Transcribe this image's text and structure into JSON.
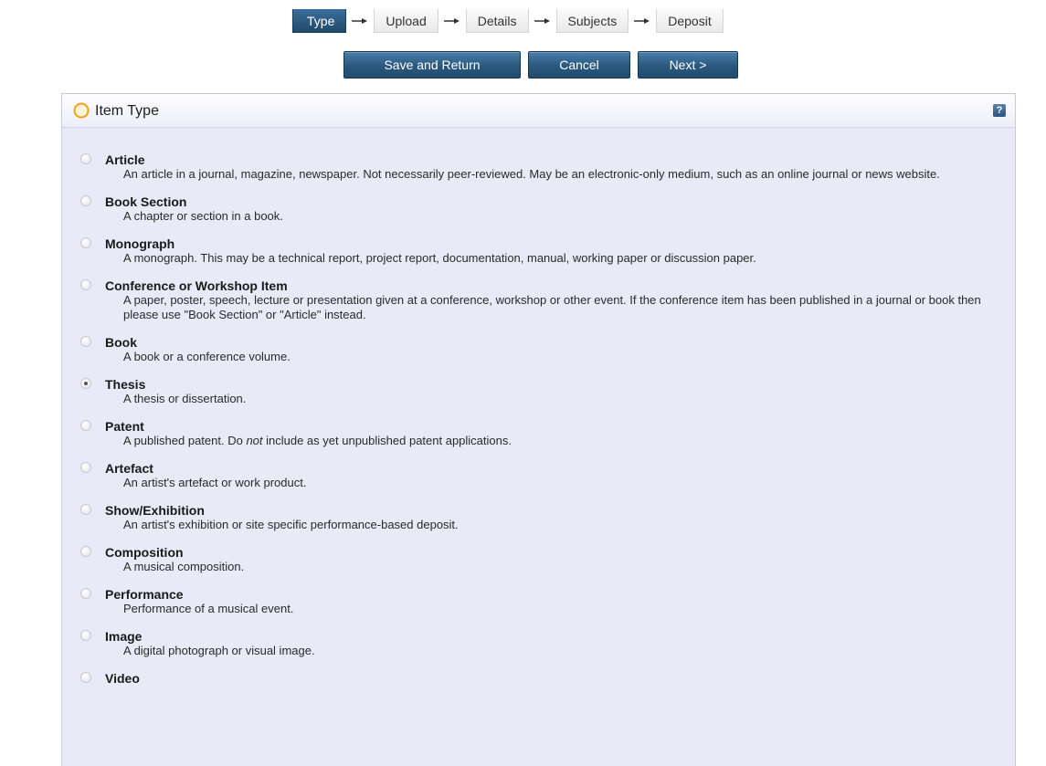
{
  "workflow": {
    "steps": [
      {
        "label": "Type",
        "active": true
      },
      {
        "label": "Upload",
        "active": false
      },
      {
        "label": "Details",
        "active": false
      },
      {
        "label": "Subjects",
        "active": false
      },
      {
        "label": "Deposit",
        "active": false
      }
    ],
    "arrow_icon": "arrow-right-icon"
  },
  "actions": {
    "save_label": "Save and Return",
    "cancel_label": "Cancel",
    "next_label": "Next >"
  },
  "panel": {
    "title": "Item Type",
    "required_icon": "required-circle-icon",
    "help_icon": "help-icon",
    "help_glyph": "?"
  },
  "item_types": [
    {
      "name": "Article",
      "description": "An article in a journal, magazine, newspaper. Not necessarily peer-reviewed. May be an electronic-only medium, such as an online journal or news website.",
      "selected": false
    },
    {
      "name": "Book Section",
      "description": "A chapter or section in a book.",
      "selected": false
    },
    {
      "name": "Monograph",
      "description": "A monograph. This may be a technical report, project report, documentation, manual, working paper or discussion paper.",
      "selected": false
    },
    {
      "name": "Conference or Workshop Item",
      "description": "A paper, poster, speech, lecture or presentation given at a conference, workshop or other event. If the conference item has been published in a journal or book then please use \"Book Section\" or \"Article\" instead.",
      "selected": false
    },
    {
      "name": "Book",
      "description": "A book or a conference volume.",
      "selected": false
    },
    {
      "name": "Thesis",
      "description": "A thesis or dissertation.",
      "selected": true
    },
    {
      "name": "Patent",
      "description_parts": [
        "A published patent. Do ",
        "not",
        " include as yet unpublished patent applications."
      ],
      "selected": false
    },
    {
      "name": "Artefact",
      "description": "An artist's artefact or work product.",
      "selected": false
    },
    {
      "name": "Show/Exhibition",
      "description": "An artist's exhibition or site specific performance-based deposit.",
      "selected": false
    },
    {
      "name": "Composition",
      "description": "A musical composition.",
      "selected": false
    },
    {
      "name": "Performance",
      "description": "Performance of a musical event.",
      "selected": false
    },
    {
      "name": "Image",
      "description": "A digital photograph or visual image.",
      "selected": false
    },
    {
      "name": "Video",
      "description": "",
      "selected": false
    }
  ],
  "colors": {
    "button_blue": "#2a587e",
    "panel_background": "#e9e9f8",
    "required_orange": "#f0a020"
  }
}
